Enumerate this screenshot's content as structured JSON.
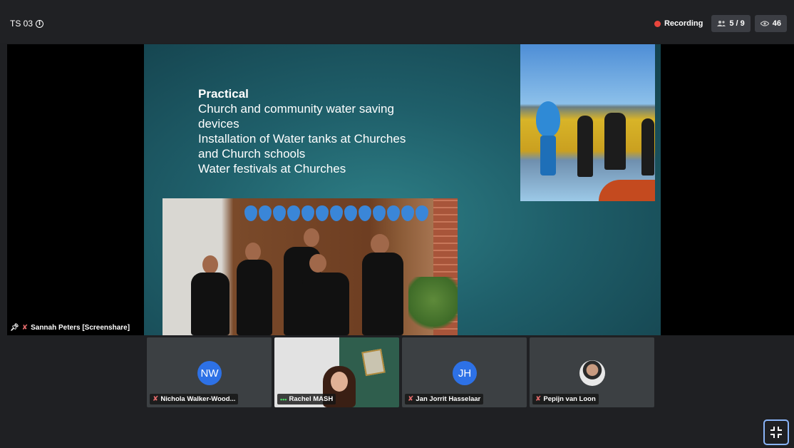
{
  "header": {
    "room_title": "TS 03",
    "recording_label": "Recording",
    "participants_count": "5 / 9",
    "viewers_count": "46"
  },
  "stage": {
    "presenter_label": "Sannah Peters [Screenshare]",
    "slide": {
      "heading": "Practical",
      "lines": [
        "Church and community water saving",
        "devices",
        "Installation of Water tanks at Churches",
        "and Church schools",
        "Water festivals at Churches"
      ]
    }
  },
  "tiles": [
    {
      "initials": "NW",
      "name": "Nichola Walker-Wood..."
    },
    {
      "initials": "",
      "name": "Rachel MASH"
    },
    {
      "initials": "JH",
      "name": "Jan Jorrit Hasselaar"
    },
    {
      "initials": "",
      "name": "Pepijn van Loon"
    }
  ],
  "colors": {
    "background": "#1f2023",
    "tile": "#3c4043",
    "avatar": "#2d71e6",
    "recording": "#e8453c",
    "focus": "#8ab4f8"
  }
}
